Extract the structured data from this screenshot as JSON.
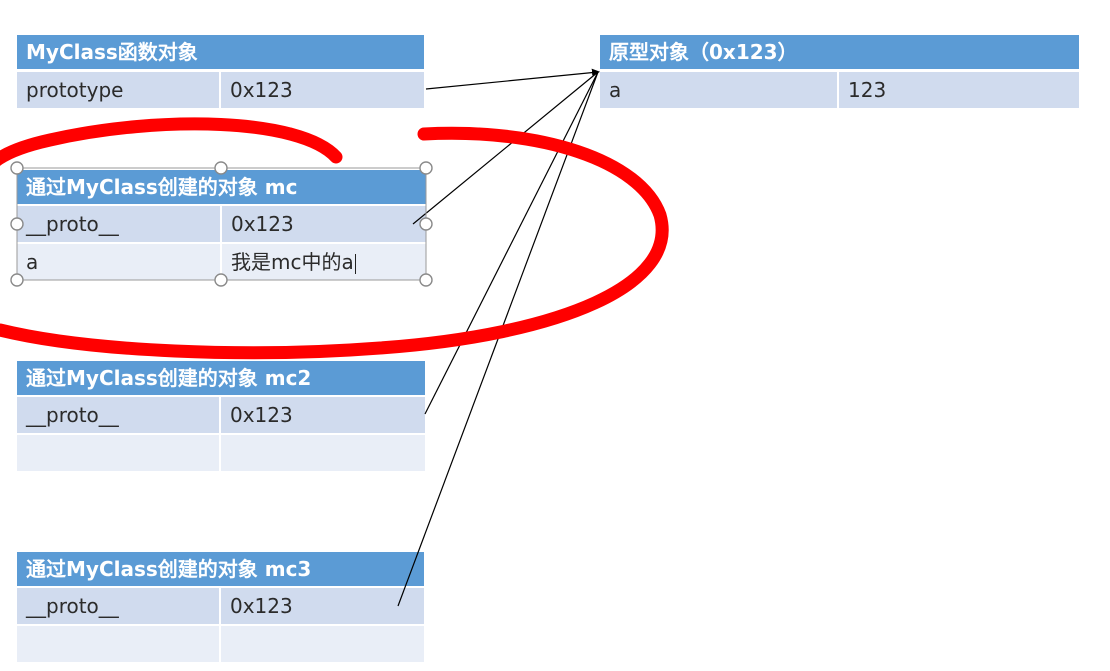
{
  "tables": {
    "myclass": {
      "title": "MyClass函数对象",
      "rows": [
        {
          "key": "prototype",
          "value": "0x123"
        }
      ]
    },
    "prototype_obj": {
      "title": "原型对象（0x123）",
      "rows": [
        {
          "key": "a",
          "value": "123"
        }
      ]
    },
    "mc": {
      "title": "通过MyClass创建的对象 mc",
      "rows": [
        {
          "key": "__proto__",
          "value": "0x123"
        },
        {
          "key": "a",
          "value": "我是mc中的a"
        }
      ]
    },
    "mc2": {
      "title": "通过MyClass创建的对象 mc2",
      "rows": [
        {
          "key": "__proto__",
          "value": "0x123"
        },
        {
          "key": "",
          "value": ""
        }
      ]
    },
    "mc3": {
      "title": "通过MyClass创建的对象 mc3",
      "rows": [
        {
          "key": "__proto__",
          "value": "0x123"
        },
        {
          "key": "",
          "value": ""
        }
      ]
    }
  },
  "colors": {
    "header": "#5b9bd5",
    "row_dark": "#d0dbee",
    "row_light": "#e9eef7",
    "annotation": "#ff0000"
  }
}
